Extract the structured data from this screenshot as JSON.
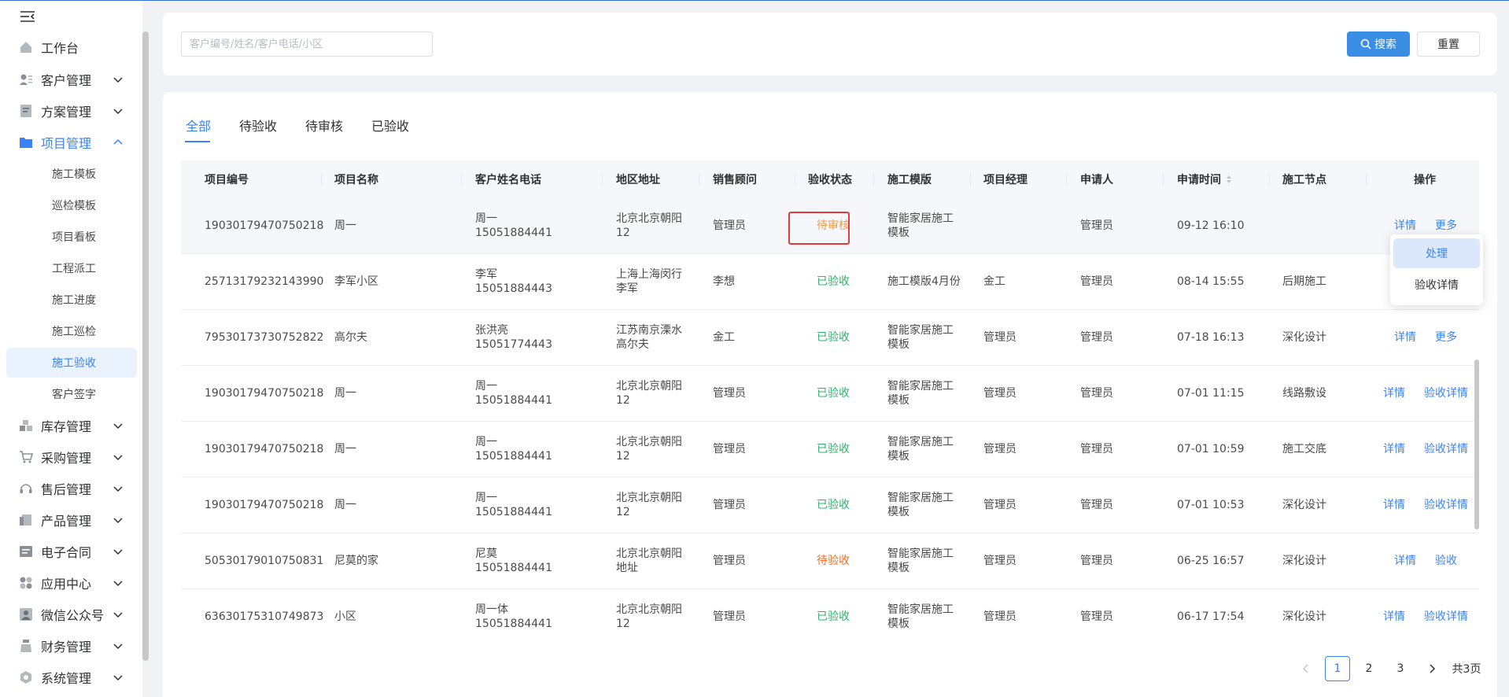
{
  "sidebar": {
    "items": [
      {
        "label": "工作台"
      },
      {
        "label": "客户管理"
      },
      {
        "label": "方案管理"
      },
      {
        "label": "项目管理"
      },
      {
        "label": "库存管理"
      },
      {
        "label": "采购管理"
      },
      {
        "label": "售后管理"
      },
      {
        "label": "产品管理"
      },
      {
        "label": "电子合同"
      },
      {
        "label": "应用中心"
      },
      {
        "label": "微信公众号"
      },
      {
        "label": "财务管理"
      },
      {
        "label": "系统管理"
      }
    ],
    "project_subitems": [
      {
        "label": "施工模板"
      },
      {
        "label": "巡检模板"
      },
      {
        "label": "项目看板"
      },
      {
        "label": "工程派工"
      },
      {
        "label": "施工进度"
      },
      {
        "label": "施工巡检"
      },
      {
        "label": "施工验收"
      },
      {
        "label": "客户签字"
      }
    ],
    "selected_subitem": "施工验收"
  },
  "search": {
    "placeholder": "客户编号/姓名/客户电话/小区",
    "search_label": "搜索",
    "reset_label": "重置"
  },
  "tabs": [
    {
      "label": "全部",
      "active": true
    },
    {
      "label": "待验收"
    },
    {
      "label": "待审核"
    },
    {
      "label": "已验收"
    }
  ],
  "table": {
    "columns": [
      "项目编号",
      "项目名称",
      "客户姓名电话",
      "地区地址",
      "销售顾问",
      "验收状态",
      "施工模版",
      "项目经理",
      "申请人",
      "申请时间",
      "施工节点",
      "操作"
    ],
    "rows": [
      {
        "id": "19030179470750218",
        "name": "周一",
        "customer": "周一",
        "phone": "15051884441",
        "addr": "北京北京朝阳12",
        "sales": "管理员",
        "status": "待审核",
        "template": "智能家居施工模板",
        "manager": "",
        "applicant": "管理员",
        "time": "09-12 16:10",
        "node": "",
        "actions": [
          "详情",
          "更多"
        ]
      },
      {
        "id": "25713179232143990",
        "name": "李军小区",
        "customer": "李军",
        "phone": "15051884443",
        "addr": "上海上海闵行李军",
        "sales": "李想",
        "status": "已验收",
        "template": "施工模版4月份",
        "manager": "金工",
        "applicant": "管理员",
        "time": "08-14 15:55",
        "node": "后期施工",
        "actions": []
      },
      {
        "id": "79530173730752822",
        "name": "高尔夫",
        "customer": "张洪亮",
        "phone": "15051774443",
        "addr": "江苏南京溧水高尔夫",
        "sales": "金工",
        "status": "已验收",
        "template": "智能家居施工模板",
        "manager": "管理员",
        "applicant": "管理员",
        "time": "07-18 16:13",
        "node": "深化设计",
        "actions": [
          "详情",
          "更多"
        ]
      },
      {
        "id": "19030179470750218",
        "name": "周一",
        "customer": "周一",
        "phone": "15051884441",
        "addr": "北京北京朝阳12",
        "sales": "管理员",
        "status": "已验收",
        "template": "智能家居施工模板",
        "manager": "管理员",
        "applicant": "管理员",
        "time": "07-01 11:15",
        "node": "线路敷设",
        "actions": [
          "详情",
          "验收详情"
        ]
      },
      {
        "id": "19030179470750218",
        "name": "周一",
        "customer": "周一",
        "phone": "15051884441",
        "addr": "北京北京朝阳12",
        "sales": "管理员",
        "status": "已验收",
        "template": "智能家居施工模板",
        "manager": "管理员",
        "applicant": "管理员",
        "time": "07-01 10:59",
        "node": "施工交底",
        "actions": [
          "详情",
          "验收详情"
        ]
      },
      {
        "id": "19030179470750218",
        "name": "周一",
        "customer": "周一",
        "phone": "15051884441",
        "addr": "北京北京朝阳12",
        "sales": "管理员",
        "status": "已验收",
        "template": "智能家居施工模板",
        "manager": "管理员",
        "applicant": "管理员",
        "time": "07-01 10:53",
        "node": "深化设计",
        "actions": [
          "详情",
          "验收详情"
        ]
      },
      {
        "id": "50530179010750831",
        "name": "尼莫的家",
        "customer": "尼莫",
        "phone": "15051884441",
        "addr": "北京北京朝阳地址",
        "sales": "管理员",
        "status": "待验收",
        "template": "智能家居施工模板",
        "manager": "管理员",
        "applicant": "管理员",
        "time": "06-25 16:57",
        "node": "深化设计",
        "actions": [
          "详情",
          "验收"
        ]
      },
      {
        "id": "63630175310749873",
        "name": "小区",
        "customer": "周一体",
        "phone": "15051884441",
        "addr": "北京北京朝阳12",
        "sales": "管理员",
        "status": "已验收",
        "template": "智能家居施工模板",
        "manager": "管理员",
        "applicant": "管理员",
        "time": "06-17 17:54",
        "node": "深化设计",
        "actions": [
          "详情",
          "验收详情"
        ]
      }
    ]
  },
  "dropdown": {
    "items": [
      "处理",
      "验收详情"
    ]
  },
  "pagination": {
    "pages": [
      "1",
      "2",
      "3"
    ],
    "current": "1",
    "total_label": "共3页"
  },
  "colors": {
    "primary": "#3a82f7",
    "accepted": "#2fb26b",
    "pending_acceptance": "#f56c1b",
    "pending_review": "#f79a44",
    "highlight": "#e23b3b"
  }
}
